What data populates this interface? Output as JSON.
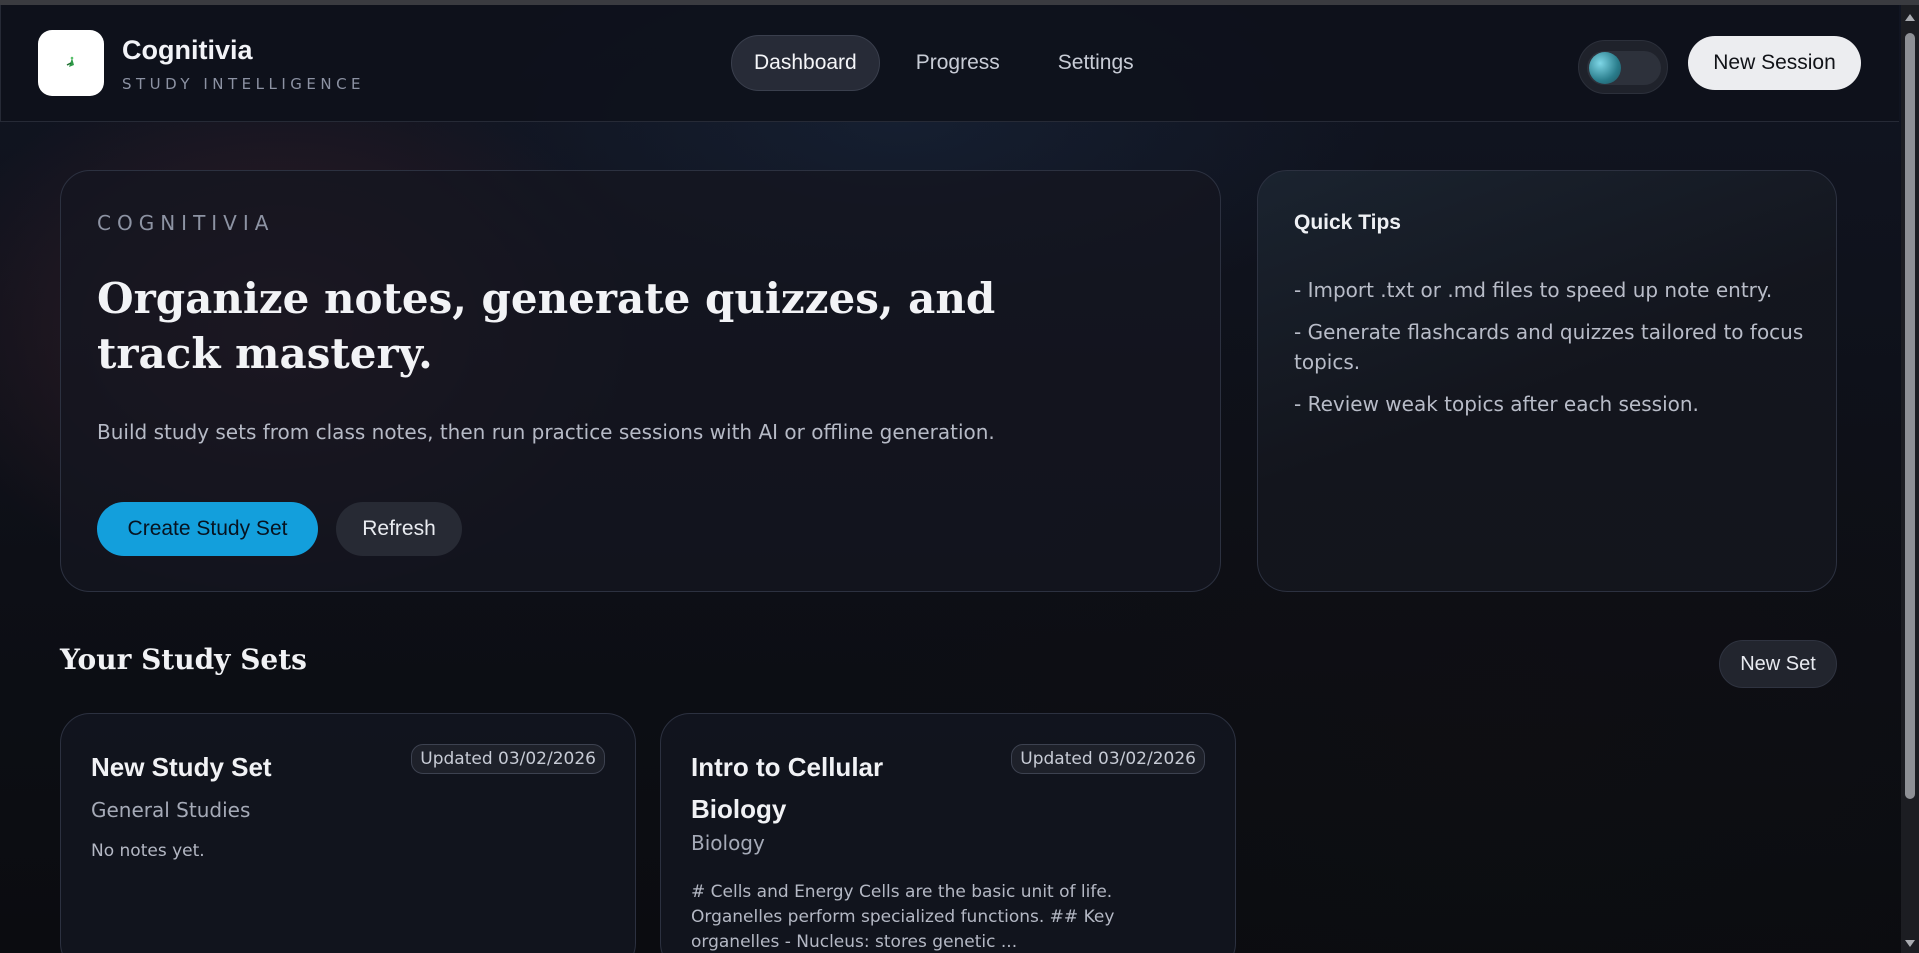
{
  "app": {
    "name": "Cognitivia",
    "tagline": "STUDY INTELLIGENCE"
  },
  "nav": {
    "items": [
      {
        "label": "Dashboard",
        "active": true
      },
      {
        "label": "Progress",
        "active": false
      },
      {
        "label": "Settings",
        "active": false
      }
    ]
  },
  "header": {
    "theme_toggle_icon": "theme-toggle",
    "new_session_label": "New Session"
  },
  "hero": {
    "eyebrow": "COGNITIVIA",
    "title": "Organize notes, generate quizzes, and track mastery.",
    "subtitle": "Build study sets from class notes, then run practice sessions with AI or offline generation.",
    "primary_button": "Create Study Set",
    "secondary_button": "Refresh"
  },
  "tips": {
    "title": "Quick Tips",
    "items": [
      "- Import .txt or .md files to speed up note entry.",
      "- Generate flashcards and quizzes tailored to focus topics.",
      "- Review weak topics after each session."
    ]
  },
  "study_sets": {
    "title": "Your Study Sets",
    "new_set_label": "New Set",
    "items": [
      {
        "title": "New Study Set",
        "updated": "Updated 03/02/2026",
        "subject": "General Studies",
        "notes": "No notes yet."
      },
      {
        "title": "Intro to Cellular Biology",
        "updated": "Updated 03/02/2026",
        "subject": "Biology",
        "notes": "# Cells and Energy Cells are the basic unit of life. Organelles perform specialized functions. ## Key organelles - Nucleus: stores genetic ..."
      }
    ]
  },
  "colors": {
    "accent": "#139fdc",
    "background": "#0c0f17",
    "card": "#141620"
  }
}
